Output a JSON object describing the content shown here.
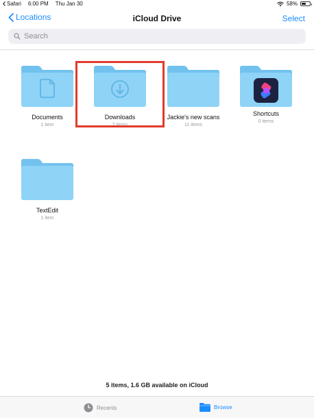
{
  "status_bar": {
    "app": "Safari",
    "time": "6:00 PM",
    "date": "Thu Jan 30",
    "battery": "58%",
    "battery_level": 0.58
  },
  "nav": {
    "back_label": "Locations",
    "title": "iCloud Drive",
    "select_label": "Select"
  },
  "search": {
    "placeholder": "Search"
  },
  "items": [
    {
      "name": "Documents",
      "count": "1 item",
      "icon": "document-icon"
    },
    {
      "name": "Downloads",
      "count": "2 items",
      "icon": "download-arrow-icon",
      "highlighted": true
    },
    {
      "name": "Jackie's new scans",
      "count": "11 items",
      "icon": "folder-icon"
    },
    {
      "name": "Shortcuts",
      "count": "0 items",
      "icon": "shortcuts-app-icon"
    },
    {
      "name": "TextEdit",
      "count": "1 item",
      "icon": "folder-icon"
    }
  ],
  "footer": {
    "summary": "5 items, 1.6 GB available on iCloud"
  },
  "tabs": [
    {
      "label": "Recents",
      "icon": "clock-icon"
    },
    {
      "label": "Browse",
      "icon": "folder-icon",
      "active": true
    }
  ],
  "colors": {
    "accent": "#1a8cff",
    "folder_front": "#8fd3f7",
    "folder_back": "#72c2ef",
    "highlight_box": "#e23a2a"
  }
}
